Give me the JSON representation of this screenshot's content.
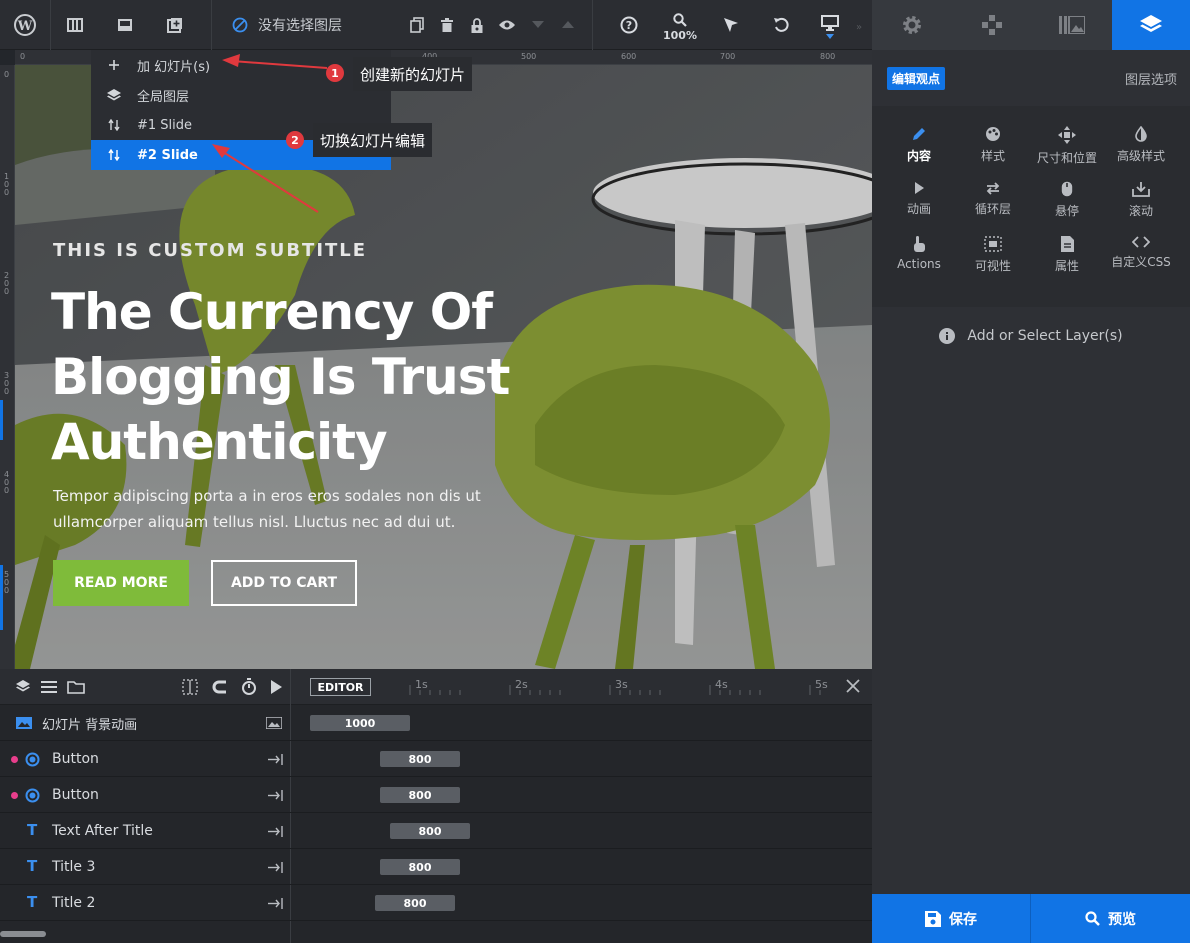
{
  "toolbar": {
    "status_text": "没有选择图层",
    "zoom_label": "100%"
  },
  "right_panel": {
    "edit_badge": "编辑观点",
    "layer_options": "图层选项",
    "grid": [
      {
        "label": "内容",
        "icon": "pencil-icon"
      },
      {
        "label": "样式",
        "icon": "palette-icon"
      },
      {
        "label": "尺寸和位置",
        "icon": "move-icon"
      },
      {
        "label": "高级样式",
        "icon": "contrast-icon"
      },
      {
        "label": "动画",
        "icon": "play-icon"
      },
      {
        "label": "循环层",
        "icon": "loop-icon"
      },
      {
        "label": "悬停",
        "icon": "mouse-icon"
      },
      {
        "label": "滚动",
        "icon": "scroll-icon"
      },
      {
        "label": "Actions",
        "icon": "hand-icon"
      },
      {
        "label": "可视性",
        "icon": "visibility-icon"
      },
      {
        "label": "属性",
        "icon": "file-icon"
      },
      {
        "label": "自定义CSS",
        "icon": "code-icon"
      }
    ],
    "add_select": "Add or Select Layer(s)",
    "save_label": "保存",
    "preview_label": "预览"
  },
  "ruler": {
    "top": [
      "0",
      "400",
      "500",
      "600",
      "700",
      "800"
    ],
    "left": [
      "0",
      "100",
      "200",
      "300",
      "400",
      "500"
    ]
  },
  "slide": {
    "subtitle": "THIS IS CUSTOM SUBTITLE",
    "title_lines": [
      "The Currency Of",
      "Blogging Is Trust",
      "Authenticity"
    ],
    "text_lines": [
      "Tempor adipiscing porta a in eros eros sodales non dis ut",
      "ullamcorper aliquam tellus nisl. Lluctus nec ad dui ut."
    ],
    "read_more": "READ MORE",
    "add_to_cart": "ADD TO CART"
  },
  "dropdown": {
    "items": [
      {
        "label": "加 幻灯片(s)",
        "icon": "plus-icon"
      },
      {
        "label": "全局图层",
        "icon": "layers-icon"
      },
      {
        "label": "#1 Slide",
        "icon": "sort-icon"
      },
      {
        "label": "#2 Slide",
        "icon": "sort-icon",
        "active": true
      }
    ]
  },
  "callouts": [
    {
      "num": "1",
      "text": "创建新的幻灯片"
    },
    {
      "num": "2",
      "text": "切换幻灯片编辑"
    }
  ],
  "timeline": {
    "editor_label": "EDITOR",
    "ticks": [
      "1s",
      "2s",
      "3s",
      "4s",
      "5s"
    ],
    "rows": [
      {
        "name": "幻灯片 背景动画",
        "value": "1000",
        "type": "bg"
      },
      {
        "name": "Button",
        "value": "800",
        "type": "button"
      },
      {
        "name": "Button",
        "value": "800",
        "type": "button"
      },
      {
        "name": "Text After Title",
        "value": "800",
        "type": "text"
      },
      {
        "name": "Title 3",
        "value": "800",
        "type": "text"
      },
      {
        "name": "Title 2",
        "value": "800",
        "type": "text"
      }
    ]
  },
  "colors": {
    "accent": "#1174e5",
    "green": "#7fbb3a",
    "callout_red": "#e0393e"
  }
}
